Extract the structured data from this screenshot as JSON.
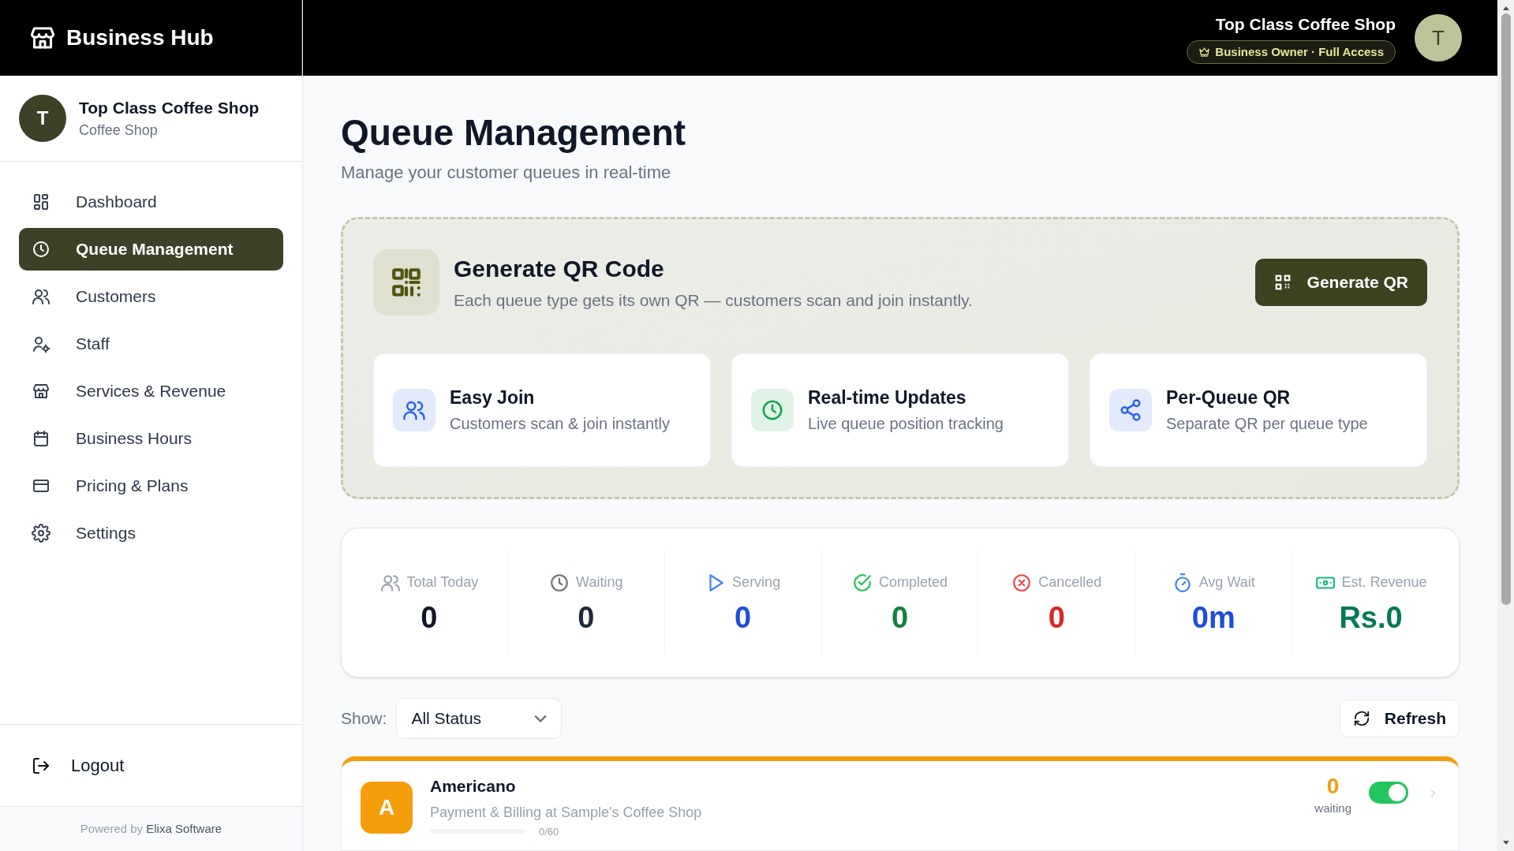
{
  "brand": {
    "name": "Business Hub"
  },
  "sidebar": {
    "profile": {
      "initial": "T",
      "name": "Top Class Coffee Shop",
      "type": "Coffee Shop"
    },
    "items": [
      {
        "label": "Dashboard",
        "selected": false
      },
      {
        "label": "Queue Management",
        "selected": true
      },
      {
        "label": "Customers",
        "selected": false
      },
      {
        "label": "Staff",
        "selected": false
      },
      {
        "label": "Services & Revenue",
        "selected": false
      },
      {
        "label": "Business Hours",
        "selected": false
      },
      {
        "label": "Pricing & Plans",
        "selected": false
      },
      {
        "label": "Settings",
        "selected": false
      }
    ],
    "logout": "Logout",
    "footer": "Powered by **Elixa Software**"
  },
  "header": {
    "shop_name": "Top Class Coffee Shop",
    "role_badge": "Business Owner · Full Access",
    "avatar_initial": "T"
  },
  "page": {
    "title": "Queue Management",
    "subtitle": "Manage your customer queues in real-time"
  },
  "qr_card": {
    "title": "Generate QR Code",
    "description": "Each queue type gets its own QR — customers scan and join instantly.",
    "button": "Generate QR",
    "features": [
      {
        "color": "#2563eb",
        "title": "Easy Join",
        "text": "Customers scan & join instantly"
      },
      {
        "color": "#16a34a",
        "title": "Real-time Updates",
        "text": "Live queue position tracking"
      },
      {
        "color": "#2563eb",
        "title": "Per-Queue QR",
        "text": "Separate QR per queue type"
      }
    ]
  },
  "stats": [
    {
      "label": "Total Today",
      "value": "0",
      "color": "#111827"
    },
    {
      "label": "Waiting",
      "value": "0",
      "color": "#1f2937"
    },
    {
      "label": "Serving",
      "value": "0",
      "color": "#1d4ed8"
    },
    {
      "label": "Completed",
      "value": "0",
      "color": "#15803d"
    },
    {
      "label": "Cancelled",
      "value": "0",
      "color": "#dc2626"
    },
    {
      "label": "Avg Wait",
      "value": "0m",
      "color": "#1d4ed8"
    },
    {
      "label": "Est. Revenue",
      "value": "Rs.0",
      "color": "#047857"
    }
  ],
  "filter": {
    "label": "Show:",
    "value": "All Status"
  },
  "refresh_button": "Refresh",
  "queues": [
    {
      "initial": "A",
      "name": "Americano",
      "description": "Payment & Billing at Sample's Coffee Shop",
      "count": "0",
      "count_label": "waiting",
      "capacity": "0/60",
      "level": 0,
      "on": true,
      "color": "#f59e0b"
    }
  ]
}
